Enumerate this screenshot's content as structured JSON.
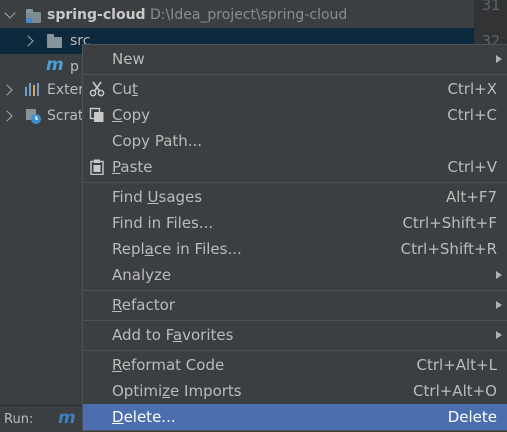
{
  "tree": {
    "project_name": "spring-cloud",
    "project_path": "D:\\Idea_project\\spring-cloud",
    "src_label": "src",
    "pom_label": "p",
    "external_label": "Exter",
    "scratches_label": "Scrat"
  },
  "gutter": {
    "line1": "31",
    "line2": "32"
  },
  "runbar": {
    "label": "Run:"
  },
  "menu": {
    "new": "New",
    "cut": {
      "pre": "Cu",
      "u": "t",
      "post": "",
      "shortcut": "Ctrl+X"
    },
    "copy": {
      "pre": "",
      "u": "C",
      "post": "opy",
      "shortcut": "Ctrl+C"
    },
    "copy_path": "Copy Path...",
    "paste": {
      "pre": "",
      "u": "P",
      "post": "aste",
      "shortcut": "Ctrl+V"
    },
    "find_usages": {
      "pre": "Find ",
      "u": "U",
      "post": "sages",
      "shortcut": "Alt+F7"
    },
    "find_in_files": {
      "label": "Find in Files...",
      "shortcut": "Ctrl+Shift+F"
    },
    "replace_in_files": {
      "pre": "Repl",
      "u": "a",
      "post": "ce in Files...",
      "shortcut": "Ctrl+Shift+R"
    },
    "analyze": "Analyze",
    "refactor": {
      "pre": "",
      "u": "R",
      "post": "efactor"
    },
    "add_to_favorites": {
      "pre": "Add to F",
      "u": "a",
      "post": "vorites"
    },
    "reformat_code": {
      "pre": "",
      "u": "R",
      "post": "eformat Code",
      "shortcut": "Ctrl+Alt+L"
    },
    "optimize_imports": {
      "pre": "Optimi",
      "u": "z",
      "post": "e Imports",
      "shortcut": "Ctrl+Alt+O"
    },
    "delete": {
      "pre": "",
      "u": "D",
      "post": "elete...",
      "shortcut": "Delete"
    }
  },
  "colors": {
    "selection": "#4b6eaf",
    "background": "#3c3f41",
    "text": "#bbbbbb"
  }
}
